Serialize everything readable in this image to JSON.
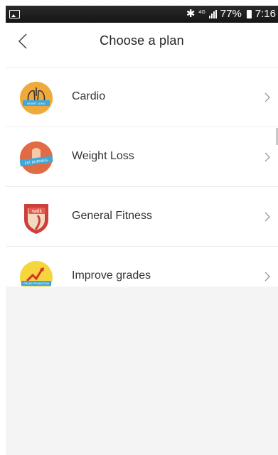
{
  "status_bar": {
    "network": "4G",
    "battery": "77%",
    "time": "7:16"
  },
  "header": {
    "title": "Choose a plan"
  },
  "plans": [
    {
      "label": "Cardio",
      "icon": "heart-lung-icon",
      "icon_text": "HEART LUNG"
    },
    {
      "label": "Weight Loss",
      "icon": "fat-burning-icon",
      "icon_text": "FAT BURNING"
    },
    {
      "label": "General Fitness",
      "icon": "walk-icon",
      "icon_text": "walk"
    },
    {
      "label": "Improve grades",
      "icon": "grade-promotion-icon",
      "icon_text": "GRADE PROMOTION"
    }
  ],
  "colors": {
    "cardio": "#f0a93b",
    "weight_loss": "#e06b45",
    "fitness": "#c9413a",
    "grades": "#f5d63d",
    "ribbon": "#3fa8d8"
  }
}
